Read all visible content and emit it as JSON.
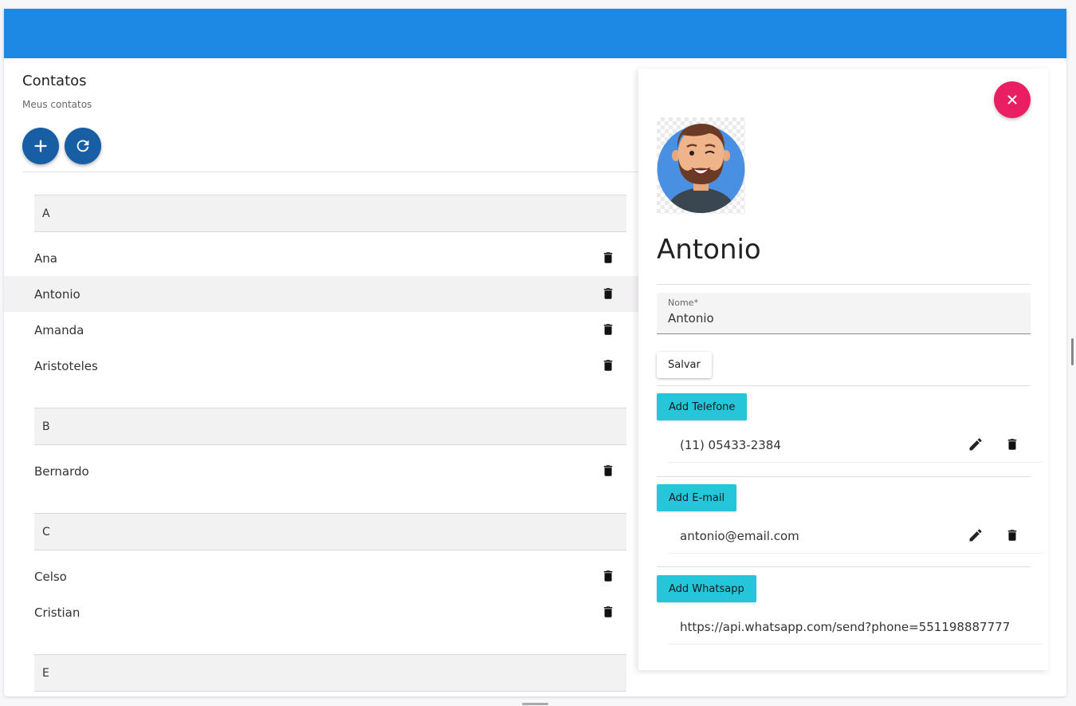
{
  "header": {
    "color": "#1e88e5"
  },
  "left": {
    "title": "Contatos",
    "subtitle": "Meus contatos",
    "add_icon": "plus-icon",
    "refresh_icon": "refresh-icon",
    "groups": [
      {
        "letter": "A",
        "contacts": [
          "Ana",
          "Antonio",
          "Amanda",
          "Aristoteles"
        ]
      },
      {
        "letter": "B",
        "contacts": [
          "Bernardo"
        ]
      },
      {
        "letter": "C",
        "contacts": [
          "Celso",
          "Cristian"
        ]
      },
      {
        "letter": "E",
        "contacts": []
      }
    ],
    "selected": "Antonio"
  },
  "detail": {
    "name": "Antonio",
    "field_label": "Nome*",
    "field_value": "Antonio",
    "save_label": "Salvar",
    "add_phone_label": "Add Telefone",
    "phone": "(11) 05433-2384",
    "add_email_label": "Add E-mail",
    "email": "antonio@email.com",
    "add_whatsapp_label": "Add Whatsapp",
    "whatsapp": "https://api.whatsapp.com/send?phone=551198887777",
    "close_icon": "close-icon",
    "accent": "#ea1e63",
    "button_color": "#26c6da"
  }
}
